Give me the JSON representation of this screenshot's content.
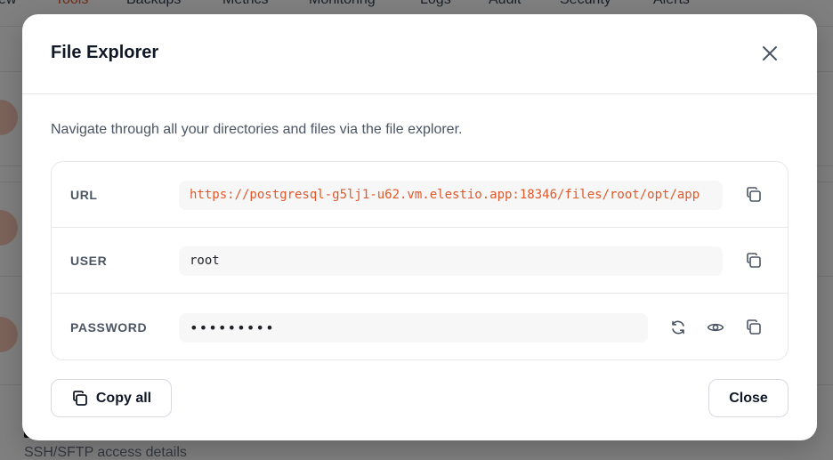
{
  "background": {
    "tabs": [
      "ew",
      "Tools",
      "Backups",
      "Metrics",
      "Monitoring",
      "Logs",
      "Audit",
      "Security",
      "Alerts"
    ],
    "active_tab": "Tools",
    "footer_sub": "SSH/SFTP access details"
  },
  "modal": {
    "title": "File Explorer",
    "description": "Navigate through all your directories and files via the file explorer.",
    "credentials": {
      "url": {
        "label": "URL",
        "value": "https://postgresql-g5lj1-u62.vm.elestio.app:18346/files/root/opt/app"
      },
      "user": {
        "label": "USER",
        "value": "root"
      },
      "password": {
        "label": "PASSWORD",
        "value": "•••••••••"
      }
    },
    "copy_all_label": "Copy all",
    "close_label": "Close"
  },
  "icons": {
    "close": "close-icon",
    "copy": "copy-icon",
    "refresh": "refresh-icon",
    "eye": "eye-icon"
  },
  "colors": {
    "accent": "#e2582a",
    "text": "#111827",
    "muted": "#4b5563",
    "border": "#e5e7eb",
    "field_bg": "#f7f7f8"
  }
}
